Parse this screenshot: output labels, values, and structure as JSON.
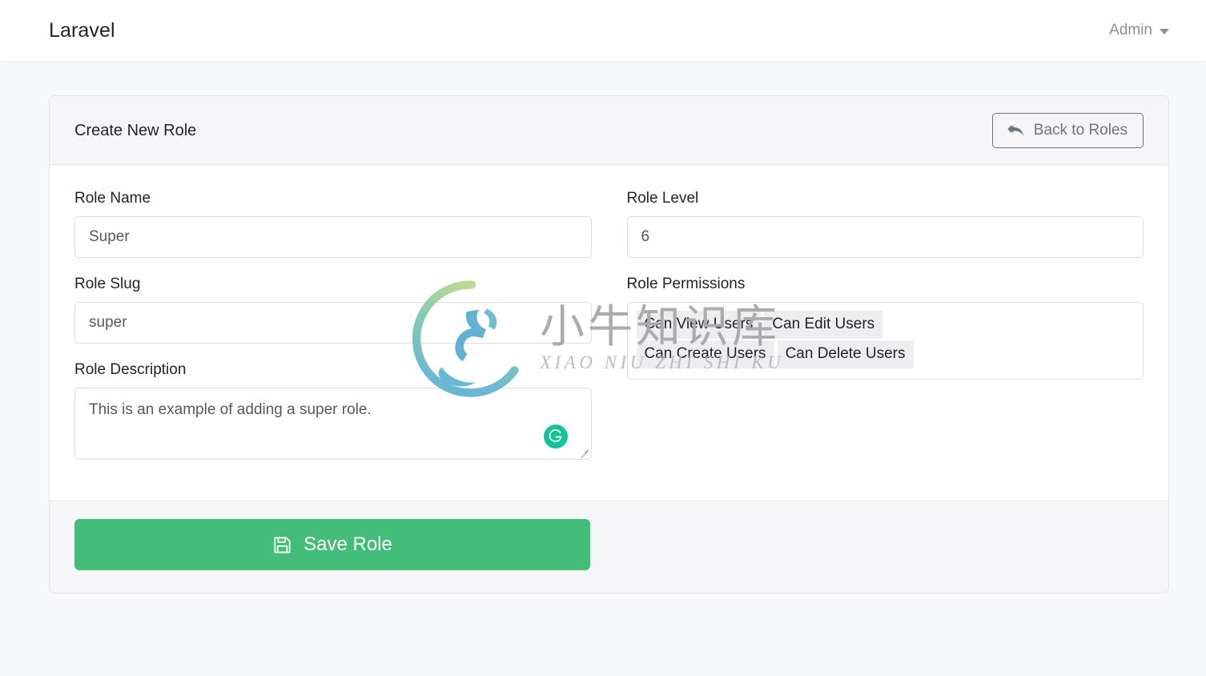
{
  "navbar": {
    "brand": "Laravel",
    "user": "Admin",
    "caret_icon": "chevron-down-icon"
  },
  "card": {
    "title": "Create New Role",
    "back_button": {
      "label": "Back to Roles",
      "icon": "reply-all-icon"
    }
  },
  "form": {
    "role_name": {
      "label": "Role Name",
      "value": "Super",
      "placeholder": "Role Name"
    },
    "role_slug": {
      "label": "Role Slug",
      "value": "super",
      "placeholder": "Role Slug"
    },
    "role_description": {
      "label": "Role Description",
      "value": "This is an example of adding a super role.",
      "placeholder": "Role Description"
    },
    "role_level": {
      "label": "Role Level",
      "value": "6",
      "placeholder": "Role Level"
    },
    "role_permissions": {
      "label": "Role Permissions",
      "selected": [
        "Can View Users",
        "Can Edit Users",
        "Can Create Users",
        "Can Delete Users"
      ]
    },
    "grammarly_badge": {
      "icon": "grammarly-icon",
      "color": "#15c39a"
    }
  },
  "footer": {
    "save_button": {
      "label": "Save Role",
      "icon": "floppy-disk-save-icon",
      "color": "#43bd79"
    }
  },
  "watermark": {
    "cn": "小牛知识库",
    "en": "XIAO NIU ZHI SHI KU",
    "logo_icon": "bull-in-circle-logo"
  },
  "colors": {
    "page_background": "#f8f9fb",
    "card_background": "#ffffff",
    "card_header_background": "#f6f6f8",
    "border": "#e3e4e8",
    "accent_green": "#43bd79",
    "muted_text": "#8a9096"
  }
}
